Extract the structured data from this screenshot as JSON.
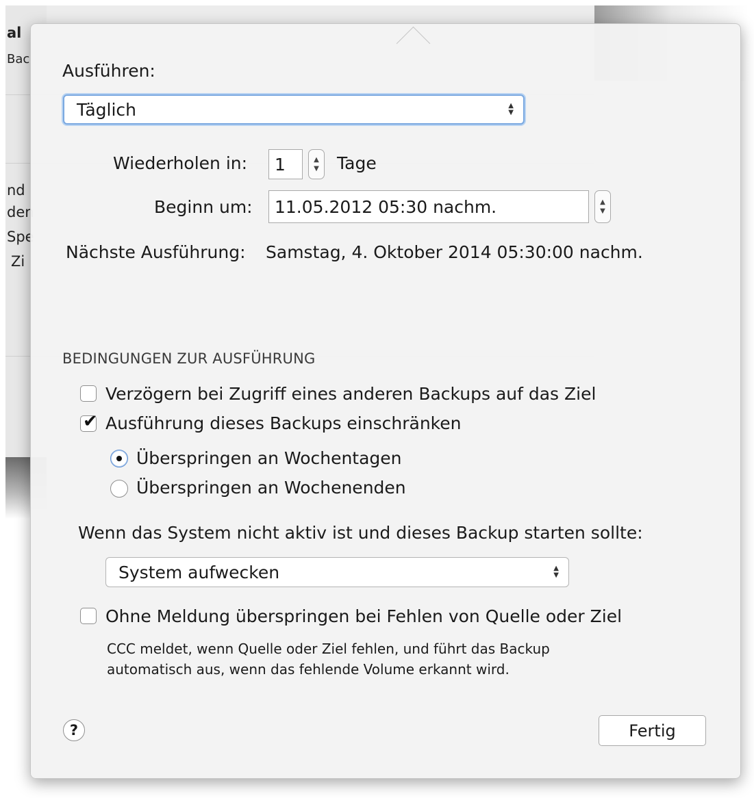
{
  "background": {
    "texts": [
      "al",
      "Bac",
      "nd",
      "den",
      "Spe",
      "Zi"
    ]
  },
  "schedule": {
    "run_label": "Ausführen:",
    "frequency_value": "Täglich",
    "repeat_label": "Wiederholen in:",
    "repeat_value": "1",
    "repeat_unit": "Tage",
    "start_label": "Beginn um:",
    "start_value": "11.05.2012 05:30 nachm.",
    "next_run_label": "Nächste Ausführung:",
    "next_run_value": "Samstag, 4. Oktober 2014 05:30:00 nachm."
  },
  "conditions": {
    "header": "BEDINGUNGEN ZUR AUSFÜHRUNG",
    "delay_label": "Verzögern bei Zugriff eines anderen Backups auf das Ziel",
    "delay_checked": false,
    "restrict_label": "Ausführung dieses Backups einschränken",
    "restrict_checked": true,
    "skip_weekdays_label": "Überspringen an Wochentagen",
    "skip_weekends_label": "Überspringen an Wochenenden",
    "selected_radio": "skip_weekdays",
    "sleep_label": "Wenn das System nicht aktiv ist und dieses Backup starten sollte:",
    "sleep_value": "System aufwecken",
    "silent_skip_label": "Ohne Meldung überspringen bei Fehlen von Quelle oder Ziel",
    "silent_skip_checked": false,
    "silent_skip_note_line1": "CCC meldet, wenn Quelle oder Ziel fehlen, und führt das Backup",
    "silent_skip_note_line2": "automatisch aus, wenn das fehlende Volume erkannt wird."
  },
  "footer": {
    "help_symbol": "?",
    "done_label": "Fertig"
  },
  "icons": {
    "popup_arrows": "up-down-arrows-icon",
    "stepper": "stepper-arrows-icon",
    "check": "checkmark-icon",
    "help": "question-mark-icon"
  }
}
